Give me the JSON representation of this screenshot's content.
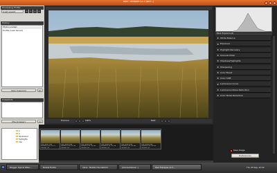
{
  "window": {
    "title": "Raw Therapee v2.3 (NEF...)"
  },
  "left": {
    "processing_profile_label": "Processing Profile",
    "profile_value": "(Last saved)",
    "history_label": "History",
    "history_items": [
      "Photo Loaded",
      "Profile (Last Saved)"
    ],
    "new_snapshot_label": "New Snapshot",
    "snapshots_label": "Snapshots",
    "left_mini_button_label": "Rn",
    "mini_button_label": "Ad",
    "folder_tree_label": "(file browser)",
    "folder_items": [
      "a",
      "a",
      "developed",
      "highlights",
      "raw"
    ]
  },
  "preview": {
    "previous_label": "Previous",
    "zoom_label": "100%",
    "next_label": "Next"
  },
  "filmstrip": {
    "thumbnails": [
      [
        "DSC_0017.nef",
        "2008-03-11 13:57",
        "ISO100 f/8"
      ],
      [
        "DSC_0018.nef",
        "2008-03-11 13:58",
        "ISO100 f/8"
      ],
      [
        "DSC_0019.nef",
        "2008-03-11 13:58",
        "ISO100 f/8"
      ],
      [
        "DSC_0020.nef",
        "2008-03-11 13:59",
        "ISO100 f/8"
      ],
      [
        "DSC_0021.nef",
        "2008-03-11 14:00",
        "ISO100 f/8"
      ],
      [
        "DSC_0022.nef",
        "2008-03-11 14:01",
        "ISO100 f/8"
      ]
    ]
  },
  "right": {
    "histogram_label": "Histogram",
    "tabs_label": "Basic Exposure (B)",
    "tools": [
      "White Balance",
      "Exposure",
      "Highlight Recovery",
      "Channel Mixer",
      "Shadows/Highlights",
      "Sharpening",
      "Color Boost",
      "Color Shift",
      "Luminance Curve",
      "Luminance Noise Reduction",
      "Color Noise Reduction"
    ],
    "save_label": "Save Image",
    "preferences_label": "Preferences"
  },
  "taskbar": {
    "items": [
      "Blogger: Rjarret Wilso...",
      "Mozilla Firefox",
      "Inbox - Mozilla Thunderbird",
      "[/home/shared/...]",
      "Raw Therapee v2.3..."
    ],
    "clock": "Thu 25 Sep, 21:52"
  },
  "colors": {
    "title_bar": "#d6642a",
    "accent_orange": "#e8732c",
    "panel_bg": "#2a2a2a",
    "light_panel": "#d7d5cf"
  }
}
